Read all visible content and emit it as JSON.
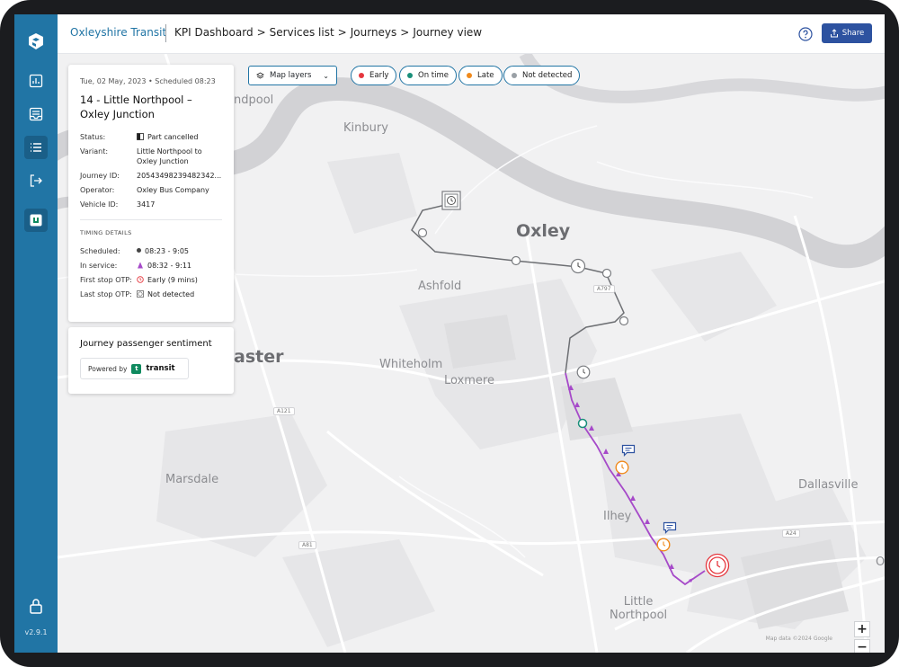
{
  "app": {
    "brand": "Oxleyshire Transit",
    "breadcrumbs": [
      "KPI Dashboard",
      "Services list",
      "Journeys",
      "Journey view"
    ],
    "crumb_separator": ">",
    "share_label": "Share",
    "version": "v2.9.1"
  },
  "sidebar": {
    "items": [
      {
        "name": "chart-icon"
      },
      {
        "name": "inbox-icon"
      },
      {
        "name": "list-icon",
        "active": true
      },
      {
        "name": "logout-icon"
      },
      {
        "name": "transit-app-icon"
      }
    ]
  },
  "map": {
    "layers_label": "Map layers",
    "legend": [
      {
        "label": "Early",
        "color": "#e5373e"
      },
      {
        "label": "On time",
        "color": "#1a8f7a"
      },
      {
        "label": "Late",
        "color": "#f08a1c"
      },
      {
        "label": "Not detected",
        "color": "#9aa0a6"
      }
    ],
    "places": {
      "kinbury": "Kinbury",
      "oxley": "Oxley",
      "ashfold": "Ashfold",
      "whiteholm": "Whiteholm",
      "loxmere": "Loxmere",
      "marsdale": "Marsdale",
      "dallasville": "Dallasville",
      "ilhey": "Ilhey",
      "little_northpool": "Little\nNorthpool",
      "aster": "aster",
      "ndpool": "ndpool",
      "edge_o": "O"
    },
    "roads": {
      "a797": "A797",
      "a121": "A121",
      "a81": "A81",
      "a24": "A24"
    },
    "attribution": "Map data ©2024 Google",
    "zoom_in": "+",
    "zoom_out": "−"
  },
  "journey": {
    "date_line": "Tue, 02 May, 2023 • Scheduled 08:23",
    "title": "14 - Little Northpool – Oxley Junction",
    "fields": {
      "status_label": "Status:",
      "status_value": "Part cancelled",
      "variant_label": "Variant:",
      "variant_value": "Little Northpool to Oxley Junction",
      "journey_id_label": "Journey ID:",
      "journey_id_value": "20543498239482342...",
      "operator_label": "Operator:",
      "operator_value": "Oxley Bus Company",
      "vehicle_label": "Vehicle ID:",
      "vehicle_value": "3417"
    },
    "timing_heading": "TIMING DETAILS",
    "timing": {
      "scheduled_label": "Scheduled:",
      "scheduled_value": "08:23 - 9:05",
      "in_service_label": "In service:",
      "in_service_value": "08:32 - 9:11",
      "first_stop_label": "First stop OTP:",
      "first_stop_value": "Early (9 mins)",
      "last_stop_label": "Last stop OTP:",
      "last_stop_value": "Not detected"
    }
  },
  "sentiment": {
    "title": "Journey passenger sentiment",
    "powered_by": "Powered by",
    "provider": "transit"
  }
}
